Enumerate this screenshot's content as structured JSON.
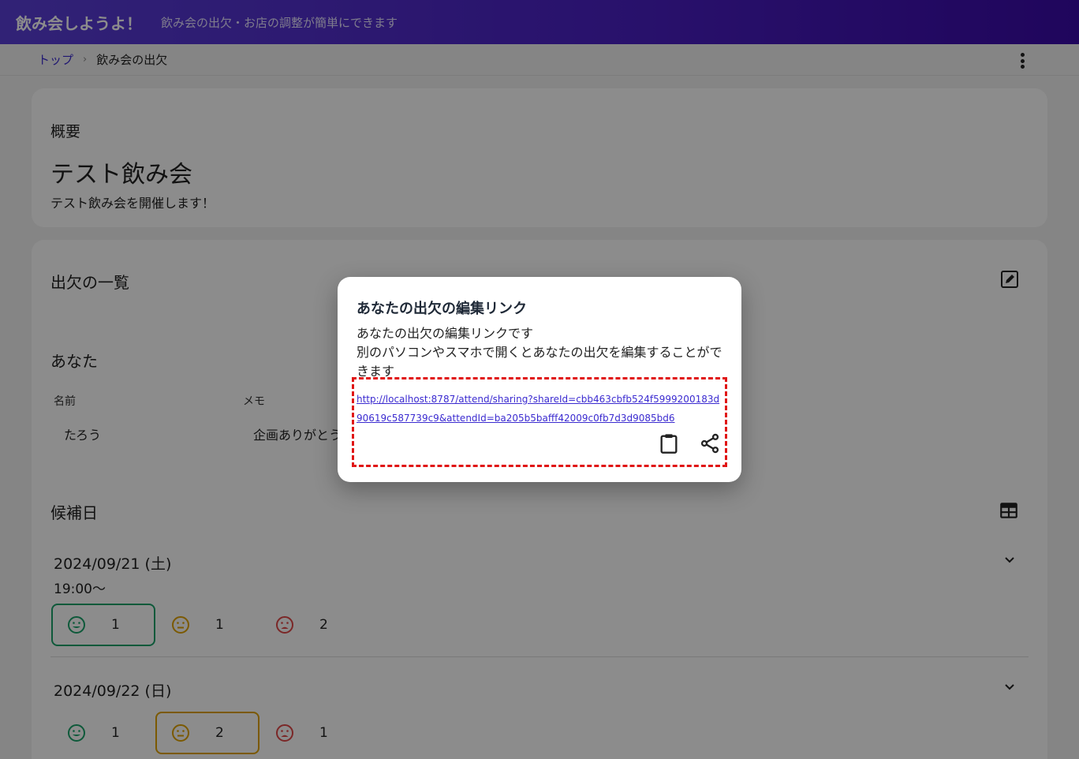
{
  "app": {
    "title": "飲み会しようよ！",
    "subtitle": "飲み会の出欠・お店の調整が簡単にできます"
  },
  "breadcrumb": {
    "home": "トップ",
    "separator": "›",
    "current": "飲み会の出欠"
  },
  "summary": {
    "label": "概要",
    "event_title": "テスト飲み会",
    "event_desc": "テスト飲み会を開催します！"
  },
  "attendance": {
    "title": "出欠の一覧",
    "you_title": "あなた",
    "columns": {
      "name": "名前",
      "memo": "メモ"
    },
    "you_row": {
      "name": "たろう",
      "memo": "企画ありがとう"
    }
  },
  "candidates": {
    "title": "候補日",
    "days": [
      {
        "date": "2024/09/21 (土)",
        "time": "19:00～",
        "ok": "1",
        "maybe": "1",
        "ng": "2",
        "selected": "ok"
      },
      {
        "date": "2024/09/22 (日)",
        "time": "",
        "ok": "1",
        "maybe": "2",
        "ng": "1",
        "selected": "maybe"
      }
    ]
  },
  "dialog": {
    "title": "あなたの出欠の編集リンク",
    "body_line1": "あなたの出欠の編集リンクです",
    "body_line2": "別のパソコンやスマホで開くとあなたの出欠を編集することができます",
    "link": "http://localhost:8787/attend/sharing?shareId=cbb463cbfb524f5999200183d90619c587739c9&attendId=ba205b5bafff42009c0fb7d3d9085bd6"
  },
  "colors": {
    "appbar": "#4a1fc4",
    "link": "#3b2bd0",
    "ok": "#1aa36a",
    "maybe": "#e0a200",
    "ng": "#e04848",
    "highlight": "#e01515"
  }
}
